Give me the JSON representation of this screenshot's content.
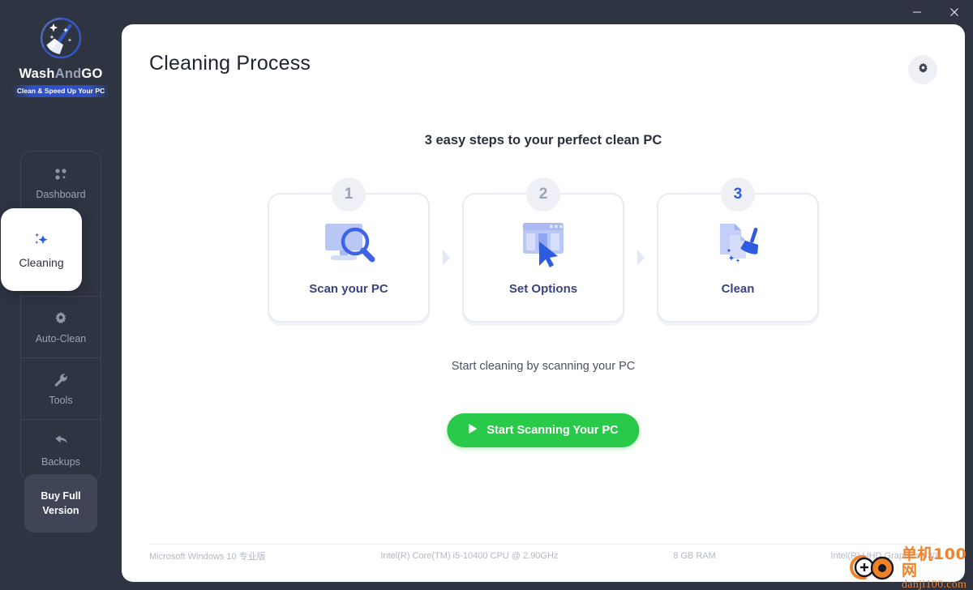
{
  "window": {
    "minimize_label": "minimize",
    "close_label": "close"
  },
  "brand": {
    "name_first": "Wash",
    "name_mid": "And",
    "name_last": "GO",
    "tagline": "Clean & Speed Up Your PC",
    "logo_icon": "broom-sparkle-icon"
  },
  "sidebar": {
    "items": [
      {
        "label": "Dashboard",
        "icon": "grid-dots-icon",
        "active": false
      },
      {
        "label": "Cleaning",
        "icon": "sparkle-icon",
        "active": true
      },
      {
        "label": "Auto-Clean",
        "icon": "gear-icon",
        "active": false
      },
      {
        "label": "Tools",
        "icon": "wrench-icon",
        "active": false
      },
      {
        "label": "Backups",
        "icon": "undo-arrow-icon",
        "active": false
      }
    ],
    "buy_button": "Buy Full Version",
    "buy_button_line1": "Buy Full",
    "buy_button_line2": "Version"
  },
  "header": {
    "title": "Cleaning Process",
    "settings_icon": "gear-icon"
  },
  "main": {
    "subheading": "3 easy steps to your perfect clean PC",
    "steps": [
      {
        "number": "1",
        "label": "Scan your PC",
        "icon": "monitor-magnifier-icon",
        "number_active": false
      },
      {
        "number": "2",
        "label": "Set Options",
        "icon": "window-cursor-icon",
        "number_active": false
      },
      {
        "number": "3",
        "label": "Clean",
        "icon": "files-brush-icon",
        "number_active": true
      }
    ],
    "hint": "Start cleaning by scanning your PC",
    "cta_label": "Start Scanning Your PC",
    "cta_icon": "play-icon",
    "cta_color": "#29c949"
  },
  "footer": {
    "os": "Microsoft Windows 10 专业版",
    "cpu": "Intel(R) Core(TM) i5-10400 CPU @ 2.90GHz",
    "ram": "8 GB RAM",
    "gpu": "Intel(R) UHD Graphics 630"
  },
  "watermark": {
    "cn": "单机100网",
    "en": "danji100.com",
    "color": "#f0822a"
  },
  "colors": {
    "rail_bg": "#2e3442",
    "accent_blue": "#2f5be0",
    "step_label": "#3a447e",
    "green": "#29c949"
  }
}
